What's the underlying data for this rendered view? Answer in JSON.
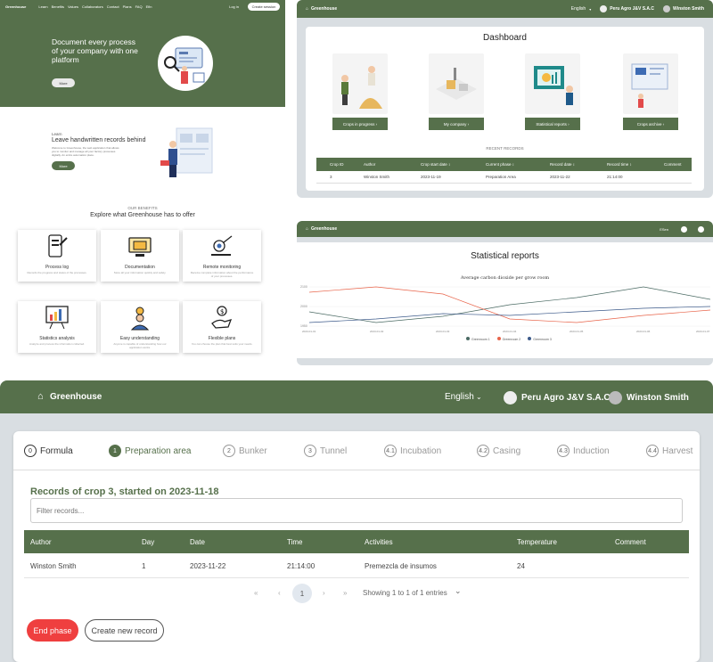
{
  "landing": {
    "brand": "Greenhouse",
    "nav_items": [
      "Learn",
      "Benefits",
      "Values",
      "Collaborators",
      "Contact",
      "Plans",
      "FAQ",
      "Efin"
    ],
    "login": "Log in",
    "create_session": "Create session",
    "hero_title": "Document every process of your company with one platform",
    "hero_button": "More",
    "learn_kicker": "Learn",
    "learn_title": "Leave handwritten records behind",
    "learn_text": "Welcome to Greenhouse, the web application that allows you to monitor and manage all your factory processes digitally. An entire automation place.",
    "learn_button": "More",
    "benefits_kicker": "OUR BENEFITS",
    "benefits_title": "Explore what Greenhouse has to offer",
    "benefits": [
      {
        "title": "Process log",
        "text": "Records the progress and status of the processes."
      },
      {
        "title": "Documentation",
        "text": "Store all your information quickly and safely."
      },
      {
        "title": "Remote monitoring",
        "text": "Receive complete information about the performance of your processes."
      },
      {
        "title": "Statistics analysis",
        "text": "Analyze and process the information collected."
      },
      {
        "title": "Easy understanding",
        "text": "Anyone is capable of understanding how our application works."
      },
      {
        "title": "Flexible plans",
        "text": "You can choose the plan that best suits your needs."
      }
    ]
  },
  "dashboard": {
    "brand": "Greenhouse",
    "language": "English",
    "company": "Peru Agro J&V S.A.C",
    "user": "Winston Smith",
    "title": "Dashboard",
    "tiles": [
      "Crops in progress ›",
      "My company ›",
      "Statistical reports ›",
      "Crops archive ›"
    ],
    "recent_label": "RECENT RECORDS",
    "columns": [
      "Crop ID",
      "Author",
      "Crop start date ↕",
      "Current phase ↕",
      "Record date ↕",
      "Record time ↕",
      "Comment"
    ],
    "row": [
      "3",
      "Winston Smith",
      "2023-11-19",
      "Preparation Area",
      "2023-11-22",
      "21:14:00",
      ""
    ]
  },
  "stats": {
    "brand": "Greenhouse",
    "language": "ESen",
    "title": "Statistical reports",
    "chart_title": "Average carbon dioxide per grow room",
    "legend": [
      "Greenroom 1",
      "Greenroom 2",
      "Greenroom 3"
    ],
    "colors": [
      "#4a6a63",
      "#e8644a",
      "#3c5a8a"
    ],
    "y_ticks": [
      "2100",
      "2000",
      "1950"
    ],
    "x_ticks": [
      "2023-01-01",
      "2023-01-02",
      "2023-01-03",
      "2023-01-04",
      "2023-01-05",
      "2023-01-06",
      "2023-01-07"
    ]
  },
  "main": {
    "brand": "Greenhouse",
    "language": "English",
    "company": "Peru Agro J&V S.A.C",
    "user": "Winston Smith",
    "steps": [
      {
        "num": "0",
        "label": "Formula",
        "state": "done"
      },
      {
        "num": "1",
        "label": "Preparation area",
        "state": "active"
      },
      {
        "num": "2",
        "label": "Bunker",
        "state": ""
      },
      {
        "num": "3",
        "label": "Tunnel",
        "state": ""
      },
      {
        "num": "4.1",
        "label": "Incubation",
        "state": ""
      },
      {
        "num": "4.2",
        "label": "Casing",
        "state": ""
      },
      {
        "num": "4.3",
        "label": "Induction",
        "state": ""
      },
      {
        "num": "4.4",
        "label": "Harvest",
        "state": ""
      }
    ],
    "records_title": "Records of crop 3, started on 2023-11-18",
    "filter_placeholder": "Filter records...",
    "columns": [
      "Author",
      "Day",
      "Date",
      "Time",
      "Activities",
      "Temperature",
      "Comment"
    ],
    "row": [
      "Winston Smith",
      "1",
      "2023-11-22",
      "21:14:00",
      "Premezcla de insumos",
      "24",
      ""
    ],
    "pager": {
      "first": "«",
      "prev": "‹",
      "page": "1",
      "next": "›",
      "last": "»",
      "summary": "Showing 1 to 1 of 1 entries"
    },
    "end_phase": "End phase",
    "create_record": "Create new record"
  }
}
